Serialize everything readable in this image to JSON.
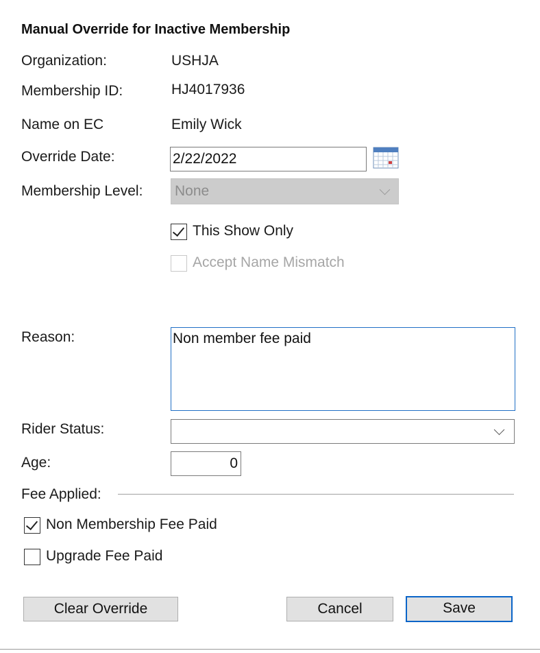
{
  "title": "Manual Override for Inactive Membership",
  "fields": {
    "organization": {
      "label": "Organization:",
      "value": "USHJA"
    },
    "membership_id": {
      "label": "Membership ID:",
      "value": "HJ4017936"
    },
    "name_on_ec": {
      "label": "Name on EC",
      "value": "Emily Wick"
    },
    "override_date": {
      "label": "Override Date:",
      "value": "2/22/2022"
    },
    "membership_level": {
      "label": "Membership Level:",
      "value": "None",
      "enabled": false
    },
    "reason": {
      "label": "Reason:",
      "value": "Non member fee paid"
    },
    "rider_status": {
      "label": "Rider Status:",
      "value": ""
    },
    "age": {
      "label": "Age:",
      "value": "0"
    }
  },
  "checkboxes": {
    "this_show_only": {
      "label": "This Show Only",
      "checked": true,
      "enabled": true
    },
    "accept_name_mismatch": {
      "label": "Accept Name Mismatch",
      "checked": false,
      "enabled": false
    }
  },
  "fee_applied": {
    "label": "Fee Applied:",
    "non_membership_fee_paid": {
      "label": "Non Membership Fee Paid",
      "checked": true
    },
    "upgrade_fee_paid": {
      "label": "Upgrade Fee Paid",
      "checked": false
    }
  },
  "buttons": {
    "clear_override": "Clear Override",
    "cancel": "Cancel",
    "save": "Save"
  },
  "icons": {
    "date_picker": "calendar-icon",
    "dropdown": "chevron-down-icon",
    "check": "checkmark-icon"
  },
  "colors": {
    "focus_border": "#1f6fc5",
    "default_button_border": "#0a64c8",
    "disabled_fill": "#cccccc",
    "disabled_text": "#a6a6a6"
  }
}
